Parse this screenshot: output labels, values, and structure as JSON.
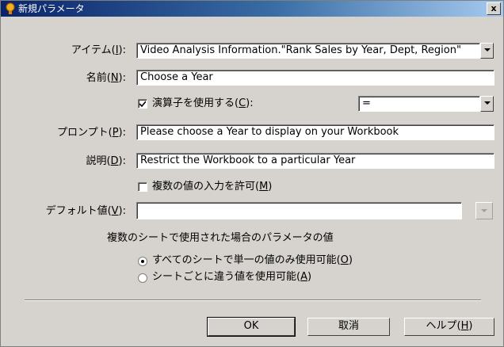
{
  "window": {
    "title": "新規パラメータ",
    "close_glyph": "x"
  },
  "item": {
    "label": "アイテム(",
    "mnemonic": "I",
    "suffix": "):",
    "value": "Video Analysis Information.\"Rank Sales by Year, Dept, Region\""
  },
  "name": {
    "label": "名前(",
    "mnemonic": "N",
    "suffix": "):",
    "value": "Choose a Year"
  },
  "operator": {
    "label": "演算子を使用する(",
    "mnemonic": "C",
    "suffix": "):",
    "checked": true,
    "value": "="
  },
  "prompt": {
    "label": "プロンプト(",
    "mnemonic": "P",
    "suffix": "):",
    "value": "Please choose a Year to display on your Workbook"
  },
  "description": {
    "label": "説明(",
    "mnemonic": "D",
    "suffix": "):",
    "value": "Restrict the Workbook to a particular Year"
  },
  "multi_value": {
    "label": "複数の値の入力を許可(",
    "mnemonic": "M",
    "suffix": ")",
    "checked": false
  },
  "default_value": {
    "label": "デフォルト値(",
    "mnemonic": "V",
    "suffix": "):",
    "value": ""
  },
  "multi_sheet": {
    "heading": "複数のシートで使用された場合のパラメータの値",
    "options": [
      {
        "label": "すべてのシートで単一の値のみ使用可能(",
        "mnemonic": "O",
        "suffix": ")",
        "selected": true
      },
      {
        "label": "シートごとに違う値を使用可能(",
        "mnemonic": "A",
        "suffix": ")",
        "selected": false
      }
    ]
  },
  "buttons": {
    "ok": "OK",
    "cancel": "取消",
    "help": {
      "label": "ヘルプ(",
      "mnemonic": "H",
      "suffix": ")"
    }
  },
  "colors": {
    "titlebar_start": "#0a246a",
    "titlebar_end": "#a6caf0",
    "dialog_bg": "#d6d3ce"
  }
}
